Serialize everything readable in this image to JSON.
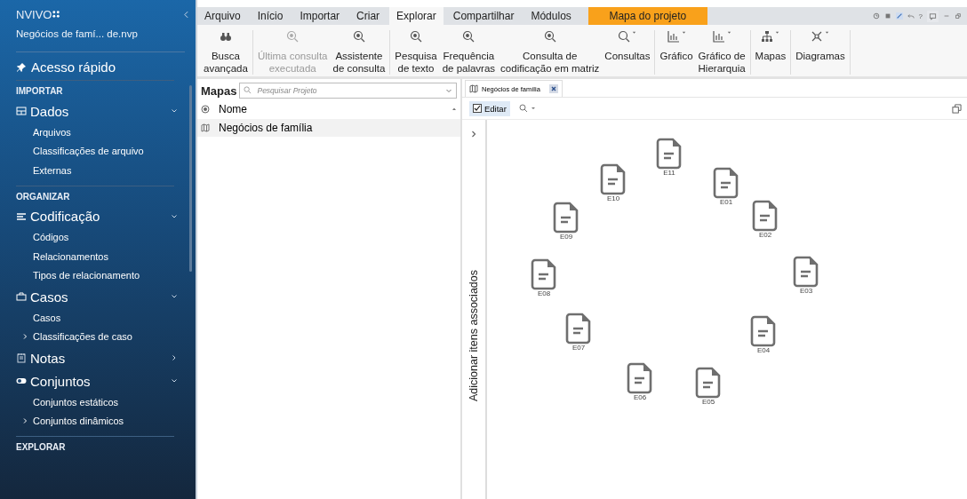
{
  "sidebar": {
    "logo": "NVIVO",
    "project": "Negócios de famí... de.nvp",
    "quick_access": "Acesso rápido",
    "sections": [
      {
        "title": "IMPORTAR",
        "groups": [
          {
            "kind": "table",
            "title": "Dados",
            "expanded": true,
            "items": [
              {
                "label": "Arquivos",
                "expandable": false
              },
              {
                "label": "Classificações de arquivo",
                "expandable": false
              },
              {
                "label": "Externas",
                "expandable": false
              }
            ]
          }
        ]
      },
      {
        "title": "ORGANIZAR",
        "groups": [
          {
            "kind": "lines",
            "title": "Codificação",
            "expanded": true,
            "items": [
              {
                "label": "Códigos",
                "expandable": false
              },
              {
                "label": "Relacionamentos",
                "expandable": false
              },
              {
                "label": "Tipos de relacionamento",
                "expandable": false
              }
            ]
          },
          {
            "kind": "case",
            "title": "Casos",
            "expanded": true,
            "items": [
              {
                "label": "Casos",
                "expandable": false
              },
              {
                "label": "Classificações de caso",
                "expandable": true
              }
            ]
          },
          {
            "kind": "notes",
            "title": "Notas",
            "expanded": false
          },
          {
            "kind": "toggle",
            "title": "Conjuntos",
            "expanded": true,
            "items": [
              {
                "label": "Conjuntos estáticos",
                "expandable": false
              },
              {
                "label": "Conjuntos dinâmicos",
                "expandable": true
              }
            ]
          }
        ]
      },
      {
        "title": "EXPLORAR"
      }
    ]
  },
  "ribbon": {
    "tabs": [
      {
        "label": "Arquivo",
        "selected": false,
        "kind": "normal"
      },
      {
        "label": "Início",
        "selected": false,
        "kind": "normal"
      },
      {
        "label": "Importar",
        "selected": false,
        "kind": "normal"
      },
      {
        "label": "Criar",
        "selected": false,
        "kind": "normal"
      },
      {
        "label": "Explorar",
        "selected": true,
        "kind": "normal"
      },
      {
        "label": "Compartilhar",
        "selected": false,
        "kind": "normal"
      },
      {
        "label": "Módulos",
        "selected": false,
        "kind": "normal"
      },
      {
        "label": "Mapa do projeto",
        "selected": false,
        "kind": "context"
      }
    ],
    "help": "?",
    "groups": [
      [
        {
          "lines": [
            "Busca",
            "avançada"
          ],
          "disabled": false,
          "dropdown": false
        }
      ],
      [
        {
          "lines": [
            "Última consulta",
            "executada"
          ],
          "disabled": true,
          "dropdown": false
        },
        {
          "lines": [
            "Assistente",
            "de consulta"
          ],
          "disabled": false,
          "dropdown": false
        }
      ],
      [
        {
          "lines": [
            "Pesquisa",
            "de texto"
          ],
          "disabled": false,
          "dropdown": false
        },
        {
          "lines": [
            "Frequência",
            "de palavras"
          ],
          "disabled": false,
          "dropdown": false
        },
        {
          "lines": [
            "Consulta de",
            "codificação em matriz"
          ],
          "disabled": false,
          "dropdown": false
        },
        {
          "lines": [
            "Consultas"
          ],
          "disabled": false,
          "dropdown": true
        }
      ],
      [
        {
          "lines": [
            "Gráfico"
          ],
          "disabled": false,
          "dropdown": true
        },
        {
          "lines": [
            "Gráfico de",
            "Hierarquia"
          ],
          "disabled": false,
          "dropdown": true
        }
      ],
      [
        {
          "lines": [
            "Mapas"
          ],
          "disabled": false,
          "dropdown": true
        }
      ],
      [
        {
          "lines": [
            "Diagramas"
          ],
          "disabled": false,
          "dropdown": true
        }
      ]
    ]
  },
  "list_pane": {
    "title": "Mapas",
    "search": {
      "placeholder": "Pesquisar Projeto"
    },
    "column": "Nome",
    "rows": [
      {
        "name": "Negócios de família",
        "selected": true
      }
    ]
  },
  "map_view": {
    "tab": "Negócios de família",
    "edit": {
      "label": "Editar",
      "checked": true
    },
    "side_panel": "Adicionar itens associados",
    "nodes": [
      {
        "label": "E11"
      },
      {
        "label": "E10"
      },
      {
        "label": "E01"
      },
      {
        "label": "E09"
      },
      {
        "label": "E02"
      },
      {
        "label": "E08"
      },
      {
        "label": "E03"
      },
      {
        "label": "E07"
      },
      {
        "label": "E04"
      },
      {
        "label": "E06"
      },
      {
        "label": "E05"
      }
    ]
  }
}
